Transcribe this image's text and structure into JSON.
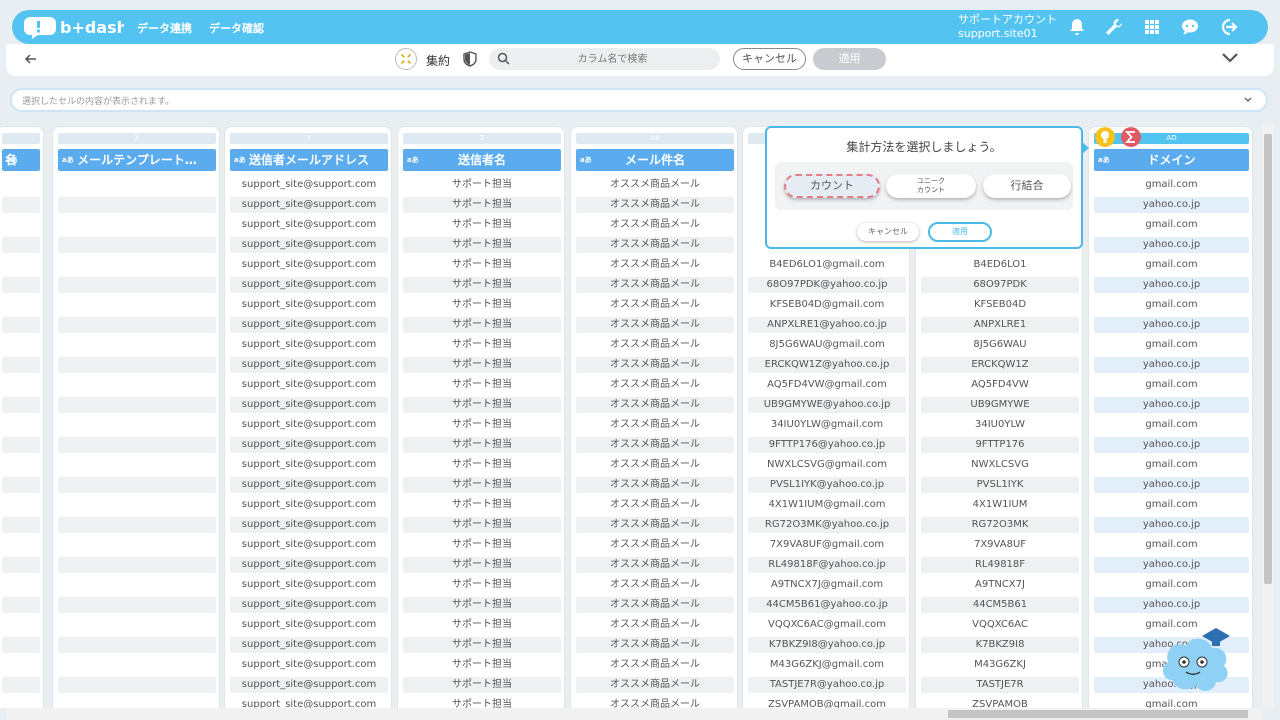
{
  "header": {
    "logo_text": "b+dash",
    "nav": [
      "データ連携",
      "データ確認"
    ],
    "account_title": "サポートアカウント",
    "account_id": "support.site01"
  },
  "toolbar": {
    "aggregate_label": "集約",
    "search_placeholder": "カラム名で検索",
    "cancel_label": "キャンセル",
    "apply_label": "適用"
  },
  "cellbar": {
    "placeholder": "選択したセルの内容が表示されます。"
  },
  "popup": {
    "title": "集計方法を選択しましょう。",
    "options": [
      "カウント",
      "ユニーク\nカウント",
      "行結合"
    ],
    "cancel_label": "キャンセル",
    "apply_label": "適用"
  },
  "columns": [
    {
      "letter": "",
      "name": "名",
      "type": "aあ"
    },
    {
      "letter": "X",
      "name": "メールテンプレート…",
      "type": "aあ"
    },
    {
      "letter": "Y",
      "name": "送信者メールアドレス",
      "type": "aあ"
    },
    {
      "letter": "Z",
      "name": "送信者名",
      "type": "aあ"
    },
    {
      "letter": "AA",
      "name": "メール件名",
      "type": "aあ"
    },
    {
      "letter": "AB",
      "name": "",
      "type": "aあ"
    },
    {
      "letter": "AC",
      "name": "",
      "type": ""
    },
    {
      "letter": "AD",
      "name": "ドメイン",
      "type": "aあ"
    }
  ],
  "rows": {
    "sender_email": "support_site@support.com",
    "sender_name": "サポート担当",
    "subject": "オススメ商品メール",
    "emails": [
      "",
      "",
      "",
      "",
      "B4ED6LO1@gmail.com",
      "68O97PDK@yahoo.co.jp",
      "KFSEB04D@gmail.com",
      "ANPXLRE1@yahoo.co.jp",
      "8J5G6WAU@gmail.com",
      "ERCKQW1Z@yahoo.co.jp",
      "AQ5FD4VW@gmail.com",
      "UB9GMYWE@yahoo.co.jp",
      "34IU0YLW@gmail.com",
      "9FTTP176@yahoo.co.jp",
      "NWXLCSVG@gmail.com",
      "PVSL1IYK@yahoo.co.jp",
      "4X1W1IUM@gmail.com",
      "RG72O3MK@yahoo.co.jp",
      "7X9VA8UF@gmail.com",
      "RL49818F@yahoo.co.jp",
      "A9TNCX7J@gmail.com",
      "44CM5B61@yahoo.co.jp",
      "VQQXC6AC@gmail.com",
      "K7BKZ9I8@yahoo.co.jp",
      "M43G6ZKJ@gmail.com",
      "TASTJE7R@yahoo.co.jp",
      "ZSVPAMOB@gmail.com"
    ],
    "ids": [
      "",
      "",
      "",
      "",
      "B4ED6LO1",
      "68O97PDK",
      "KFSEB04D",
      "ANPXLRE1",
      "8J5G6WAU",
      "ERCKQW1Z",
      "AQ5FD4VW",
      "UB9GMYWE",
      "34IU0YLW",
      "9FTTP176",
      "NWXLCSVG",
      "PVSL1IYK",
      "4X1W1IUM",
      "RG72O3MK",
      "7X9VA8UF",
      "RL49818F",
      "A9TNCX7J",
      "44CM5B61",
      "VQQXC6AC",
      "K7BKZ9I8",
      "M43G6ZKJ",
      "TASTJE7R",
      "ZSVPAMOB"
    ],
    "domains": [
      "gmail.com",
      "yahoo.co.jp",
      "gmail.com",
      "yahoo.co.jp",
      "gmail.com",
      "yahoo.co.jp",
      "gmail.com",
      "yahoo.co.jp",
      "gmail.com",
      "yahoo.co.jp",
      "gmail.com",
      "yahoo.co.jp",
      "gmail.com",
      "yahoo.co.jp",
      "gmail.com",
      "yahoo.co.jp",
      "gmail.com",
      "yahoo.co.jp",
      "gmail.com",
      "yahoo.co.jp",
      "gmail.com",
      "yahoo.co.jp",
      "gmail.com",
      "yahoo.co.jp",
      "gmail.com",
      "yahoo.co.jp",
      "gmail.com"
    ]
  },
  "colors": {
    "brand": "#53c4f2",
    "header_blue": "#5aacef",
    "accent_red": "#e05a66",
    "accent_yellow": "#f6c21b"
  },
  "icons": [
    "back-arrow-icon",
    "aggregate-icon",
    "shield-icon",
    "search-icon",
    "chevron-down-icon",
    "bell-icon",
    "wrench-icon",
    "grid-icon",
    "chat-icon",
    "logout-icon",
    "hint-icon",
    "sigma-icon",
    "mascot-icon"
  ]
}
